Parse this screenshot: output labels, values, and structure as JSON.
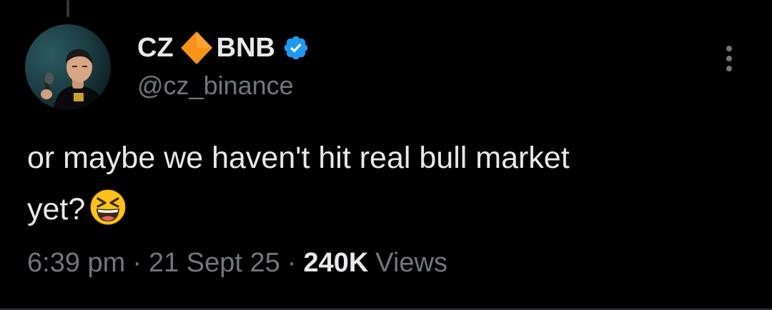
{
  "tweet": {
    "author": {
      "display_name_part1": "CZ",
      "display_name_part2": "BNB",
      "name_icon": "orange-diamond-icon",
      "verified_icon": "verified-badge-icon",
      "handle": "@cz_binance",
      "avatar_icon": "profile-photo"
    },
    "text_line1": "or maybe we haven't hit real bull market",
    "text_line2": "yet?",
    "emoji": "grinning-squinting-face-emoji",
    "time": "6:39 pm",
    "separator": "·",
    "date": "21 Sept 25",
    "views_count": "240K",
    "views_label": "Views",
    "more_icon": "more-vertical-icon"
  },
  "colors": {
    "background": "#000000",
    "primary_text": "#e7e9ea",
    "secondary_text": "#71767b",
    "verified_blue": "#1d9bf0",
    "diamond_orange": "#f7931a",
    "divider": "#2f3336"
  }
}
